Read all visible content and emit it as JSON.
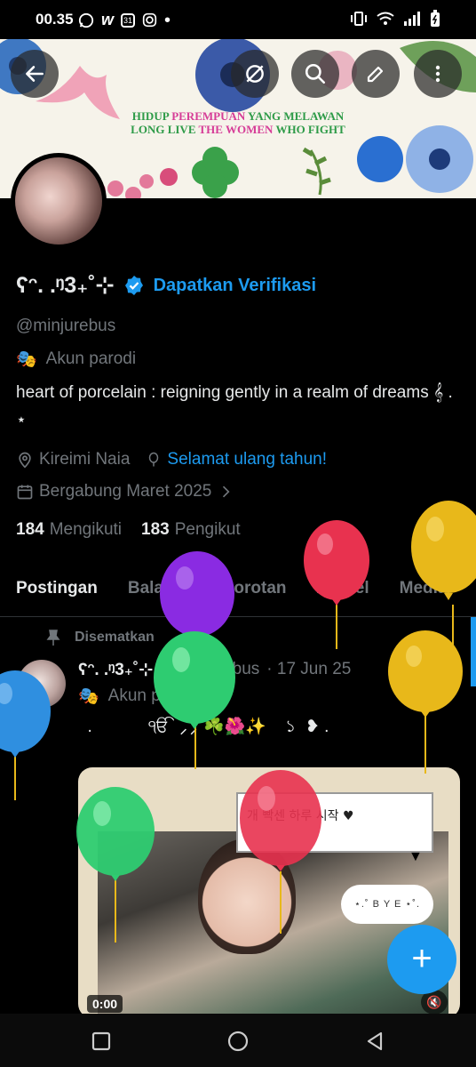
{
  "status": {
    "time": "00.35",
    "left_icons": [
      "whatsapp-icon",
      "w-app-icon",
      "calendar-icon",
      "instagram-icon",
      "dot-icon"
    ],
    "calendar_day": "31",
    "right_icons": [
      "vibrate-icon",
      "wifi-icon",
      "signal-icon",
      "battery-icon"
    ]
  },
  "header": {
    "back_icon": "arrow-left-icon",
    "actions": [
      "grok-icon",
      "search-icon",
      "edit-icon",
      "more-icon"
    ]
  },
  "banner": {
    "line1": [
      "HIDUP ",
      "PEREMPUAN",
      " YANG MELAWAN"
    ],
    "line2": [
      "LONG LIVE ",
      "THE WOMEN",
      " WHO FIGHT"
    ]
  },
  "profile": {
    "display_name": "ʕᵔ. .ᵑ3₊˚⊹",
    "verify_link": "Dapatkan Verifikasi",
    "handle": "@minjurebus",
    "parody_label": "Akun parodi",
    "bio": "heart of porcelain : reigning gently in a realm of dreams     𝄞        .  ⋆",
    "location": "Kireimi Naia",
    "birthday": "Selamat ulang tahun!",
    "joined": "Bergabung Maret 2025",
    "following_count": "184",
    "following_label": "Mengikuti",
    "followers_count": "183",
    "followers_label": "Pengikut"
  },
  "tabs": [
    "Postingan",
    "Balasan",
    "Sorotan",
    "Artikel",
    "Media"
  ],
  "active_tab": 0,
  "post": {
    "pinned_label": "Disematkan",
    "author": "ʕᵔ. .ᵑ3₊˚⊹",
    "handle": "@minjurebus",
    "date": "· 17 Jun 25",
    "parody_label": "Akun parodi",
    "text": "  .            ੴ  ⸝⸝ ☘️🌺✨    ১  ❥ .",
    "media": {
      "sticker_text": "개 빡센 하루 시작 ♥",
      "cloud_text": "⋆.˚ B Y E ⋆˚.",
      "video_time": "0:00"
    }
  },
  "fab_label": "+",
  "colors": {
    "accent": "#1d9bf0",
    "background": "#000000",
    "text": "#e7e9ea",
    "muted": "#71767b",
    "balloon_purple": "#8a2be2",
    "balloon_green": "#2ecc71",
    "balloon_red": "#e8324f",
    "balloon_yellow": "#e8b81a",
    "balloon_blue": "#2f8fe0"
  }
}
